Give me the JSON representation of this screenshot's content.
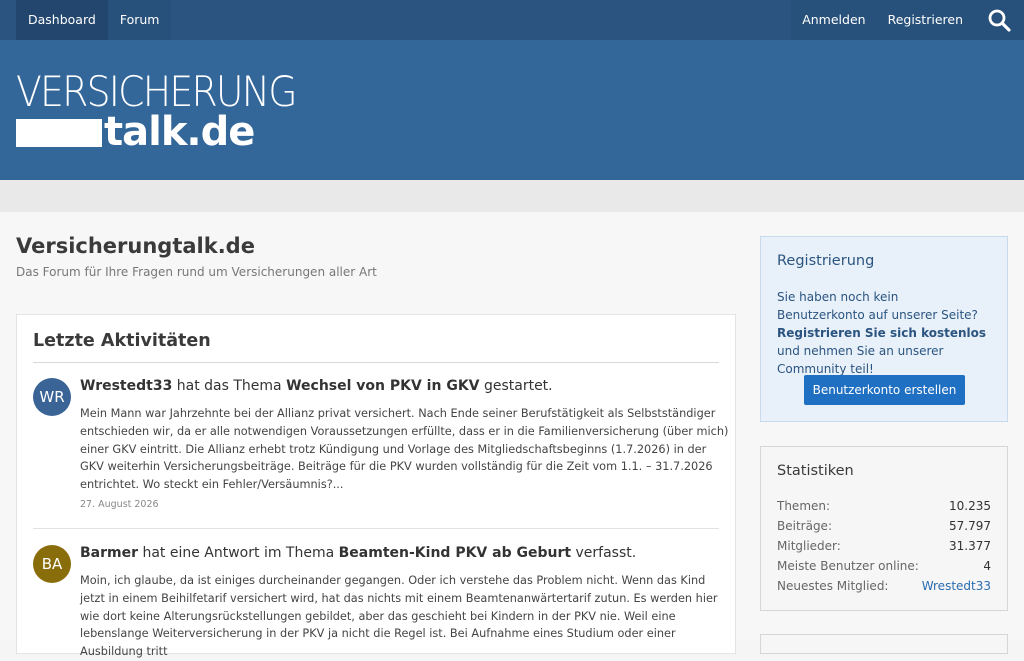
{
  "nav": {
    "dashboard": "Dashboard",
    "forum": "Forum",
    "login": "Anmelden",
    "register": "Registrieren",
    "search_icon": "search-icon"
  },
  "logo": {
    "line1": "VERSICHERUNG",
    "line2": "talk.de"
  },
  "page": {
    "title": "Versicherungtalk.de",
    "subtitle": "Das Forum für Ihre Fragen rund um Versicherungen aller Art"
  },
  "activity": {
    "heading": "Letzte Aktivitäten",
    "items": [
      {
        "avatar": "WR",
        "avatar_color": "#3a6496",
        "user": "Wrestedt33",
        "action": " hat das Thema ",
        "thread": "Wechsel von PKV in GKV",
        "suffix": " gestartet.",
        "body": "Mein Mann war Jahrzehnte bei der Allianz privat versichert. Nach Ende seiner Berufstätigkeit als Selbstständiger entschieden wir, da er alle notwendigen Voraussetzungen erfüllte, dass er in die Familienversicherung (über mich) einer GKV eintritt. Die Allianz erhebt trotz Kündigung und Vorlage des Mitgliedschaftsbeginns (1.7.2026) in der GKV weiterhin Versicherungsbeiträge. Beiträge für die PKV wurden vollständig für die Zeit vom 1.1. – 31.7.2026 entrichtet. Wo steckt ein Fehler/Versäumnis?...",
        "date": "27. August 2026"
      },
      {
        "avatar": "BA",
        "avatar_color": "#8a6d0b",
        "user": "Barmer",
        "action": " hat eine Antwort im Thema ",
        "thread": "Beamten-Kind PKV ab Geburt",
        "suffix": " verfasst.",
        "body": "Moin, ich glaube, da ist einiges durcheinander gegangen. Oder ich verstehe das Problem nicht. Wenn das Kind jetzt in einem Beihilfetarif versichert wird, hat das nichts mit einem Beamtenanwärtertarif zutun. Es werden hier wie dort keine Alterungsrückstellungen gebildet, aber das geschieht bei Kindern in der PKV nie. Weil eine lebenslange Weiterversicherung in der PKV ja nicht die Regel ist. Bei Aufnahme eines Studium oder einer Ausbildung tritt"
      }
    ]
  },
  "registration": {
    "title": "Registrierung",
    "text_pre": "Sie haben noch kein Benutzerkonto auf unserer Seite? ",
    "text_bold": "Registrieren Sie sich kostenlos",
    "text_post": " und nehmen Sie an unserer Community teil!",
    "button": "Benutzerkonto erstellen"
  },
  "stats": {
    "title": "Statistiken",
    "rows": [
      {
        "label": "Themen:",
        "value": "10.235"
      },
      {
        "label": "Beiträge:",
        "value": "57.797"
      },
      {
        "label": "Mitglieder:",
        "value": "31.377"
      },
      {
        "label": "Meiste Benutzer online:",
        "value": "4"
      },
      {
        "label": "Neuestes Mitglied:",
        "value": "Wrestedt33"
      }
    ]
  }
}
